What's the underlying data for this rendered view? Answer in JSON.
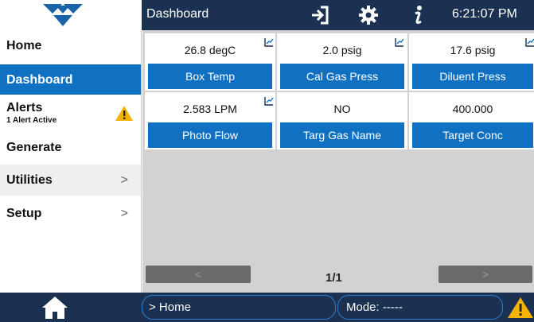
{
  "header": {
    "title": "Dashboard",
    "clock": "6:21:07 PM",
    "icons": [
      "logout-icon",
      "gear-icon",
      "info-icon"
    ],
    "bg_color": "#1a3152"
  },
  "sidebar": {
    "items": [
      {
        "label": "Home"
      },
      {
        "label": "Dashboard",
        "active": true
      },
      {
        "label": "Alerts",
        "sublabel": "1 Alert Active",
        "icon": "warning-icon"
      },
      {
        "label": "Generate"
      },
      {
        "label": "Utilities",
        "chevron": ">"
      },
      {
        "label": "Setup",
        "chevron": ">"
      }
    ],
    "accent": "#1071c2"
  },
  "dashboard": {
    "tiles": [
      {
        "value": "26.8 degC",
        "name": "Box Temp",
        "graph": true
      },
      {
        "value": "2.0 psig",
        "name": "Cal Gas Press",
        "graph": true
      },
      {
        "value": "17.6 psig",
        "name": "Diluent Press",
        "graph": true
      },
      {
        "value": "2.583 LPM",
        "name": "Photo Flow",
        "graph": true
      },
      {
        "value": "NO",
        "name": "Targ Gas Name",
        "graph": false
      },
      {
        "value": "400.000",
        "name": "Target Conc",
        "graph": false
      }
    ],
    "pager": {
      "prev": "<",
      "next": ">",
      "indicator": "1/1"
    }
  },
  "footer": {
    "breadcrumb": "> Home",
    "mode": "Mode: -----",
    "icons": [
      "home-icon",
      "warning-icon"
    ]
  }
}
